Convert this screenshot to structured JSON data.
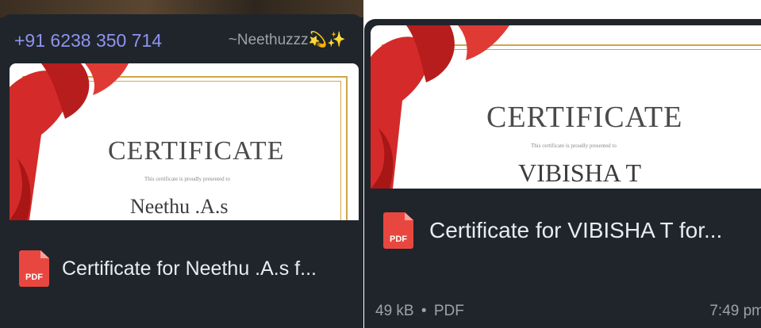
{
  "left_message": {
    "sender_phone": "+91 6238 350 714",
    "sender_name": "~Neethuzzz",
    "sender_emoji": "💫✨",
    "preview": {
      "title": "CERTIFICATE",
      "subtitle": "This certificate is proudly presented to",
      "recipient": "Neethu .A.s"
    },
    "document": {
      "icon": "pdf-icon",
      "icon_label": "PDF",
      "file_name": "Certificate for Neethu .A.s f..."
    }
  },
  "right_message": {
    "preview": {
      "title": "CERTIFICATE",
      "subtitle": "This certificate is proudly presented to",
      "recipient": "VIBISHA T"
    },
    "document": {
      "icon": "pdf-icon",
      "icon_label": "PDF",
      "file_name": "Certificate for VIBISHA T for..."
    },
    "file_size": "49 kB",
    "file_type": "PDF",
    "separator": "•",
    "time": "7:49 pm"
  },
  "colors": {
    "bubble_bg": "#1f252b",
    "sender_phone": "#8f93f0",
    "pdf_red": "#e8473f",
    "ribbon_red": "#d42a2a",
    "gold_frame": "#d2a548"
  }
}
